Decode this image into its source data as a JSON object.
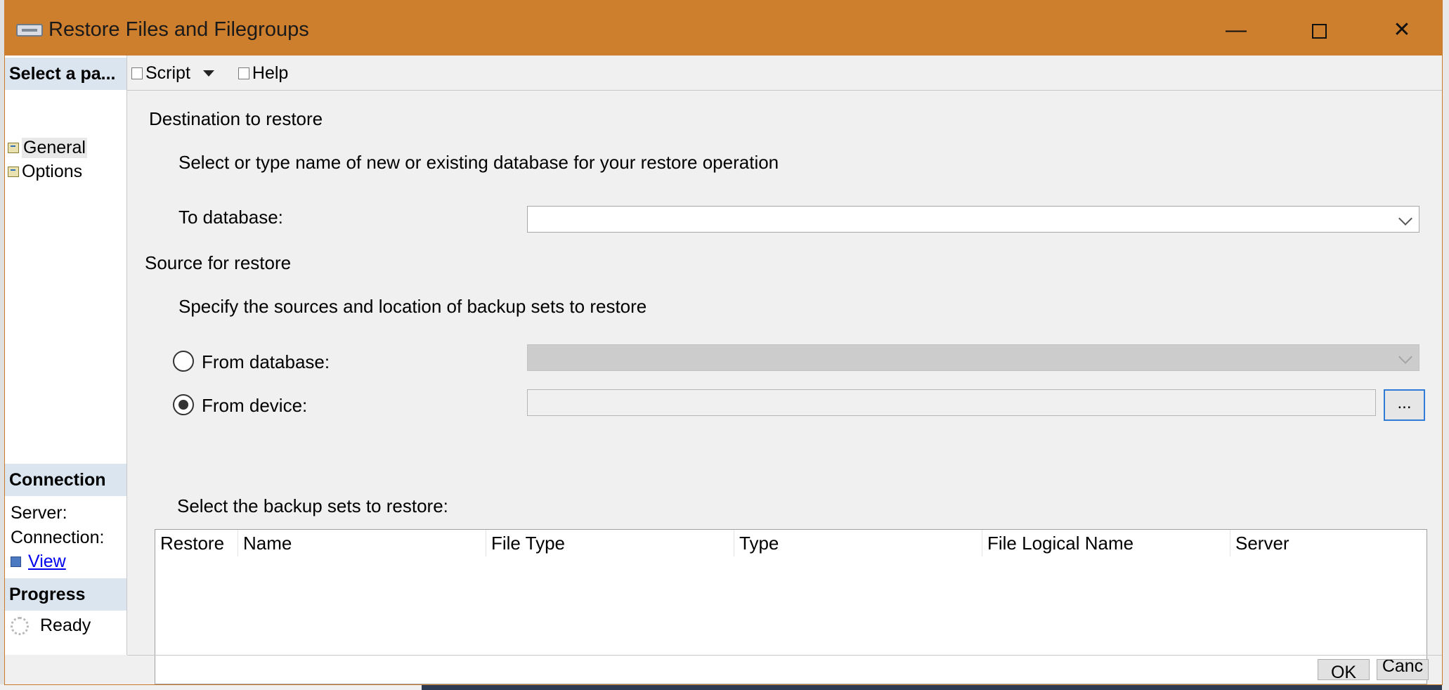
{
  "window": {
    "title": "Restore Files and Filegroups",
    "controls": {
      "minimize": "—",
      "close": "✕"
    }
  },
  "sidebar": {
    "select_page_header": "Select a pa...",
    "pages": [
      {
        "label": "General"
      },
      {
        "label": "Options"
      }
    ],
    "connection": {
      "header": "Connection",
      "server_label": "Server:",
      "connection_label": "Connection:",
      "view_link": "View "
    },
    "progress": {
      "header": "Progress",
      "status": "Ready"
    }
  },
  "toolbar": {
    "script_label": "Script",
    "help_label": "Help"
  },
  "destination": {
    "section_title": "Destination to restore",
    "description": "Select or type name of new or existing database for your restore operation",
    "to_database_label": "To database:",
    "to_database_value": ""
  },
  "source": {
    "section_title": "Source for restore",
    "description": "Specify the sources and location of backup sets to restore",
    "from_database_label": "From database:",
    "from_device_label": "From device:",
    "selected": "from_device",
    "browse_label": "..."
  },
  "backup_sets": {
    "label": "Select the backup sets to restore:",
    "columns": [
      "Restore",
      "Name",
      "File Type",
      "Type",
      "File Logical Name",
      "Server"
    ],
    "rows": []
  },
  "footer": {
    "ok_label": "OK",
    "cancel_label": "Canc"
  },
  "colors": {
    "titlebar": "#cd7f2e",
    "section_header": "#dbe5ef",
    "focus_border": "#2f7bd6",
    "link": "#0000ee"
  }
}
